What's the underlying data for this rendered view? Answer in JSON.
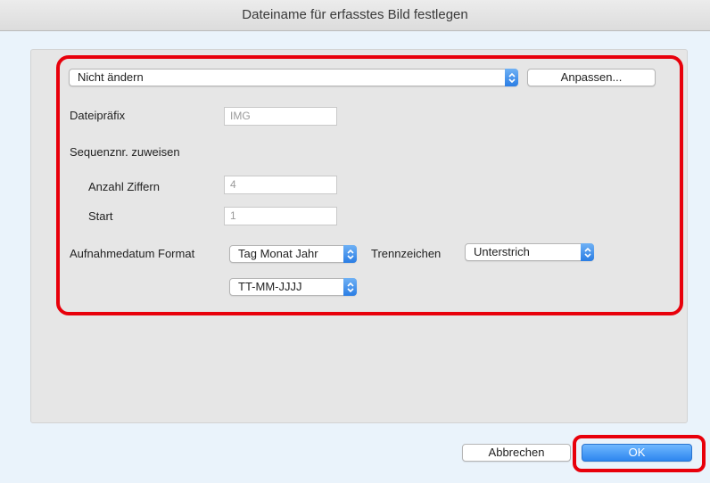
{
  "window": {
    "title": "Dateiname für erfasstes Bild festlegen"
  },
  "naming_preset": {
    "selected": "Nicht ändern",
    "customize_label": "Anpassen..."
  },
  "prefix": {
    "label": "Dateipräfix",
    "value": "IMG"
  },
  "sequence": {
    "label": "Sequenznr. zuweisen",
    "digits_label": "Anzahl Ziffern",
    "digits_value": "4",
    "start_label": "Start",
    "start_value": "1"
  },
  "capture_date": {
    "label": "Aufnahmedatum Format",
    "order_selected": "Tag Monat Jahr",
    "format_selected": "TT-MM-JJJJ"
  },
  "separator": {
    "label": "Trennzeichen",
    "selected": "Unterstrich"
  },
  "footer": {
    "cancel_label": "Abbrechen",
    "ok_label": "OK"
  },
  "colors": {
    "highlight": "#e8000b",
    "accent": "#2e86ef"
  }
}
